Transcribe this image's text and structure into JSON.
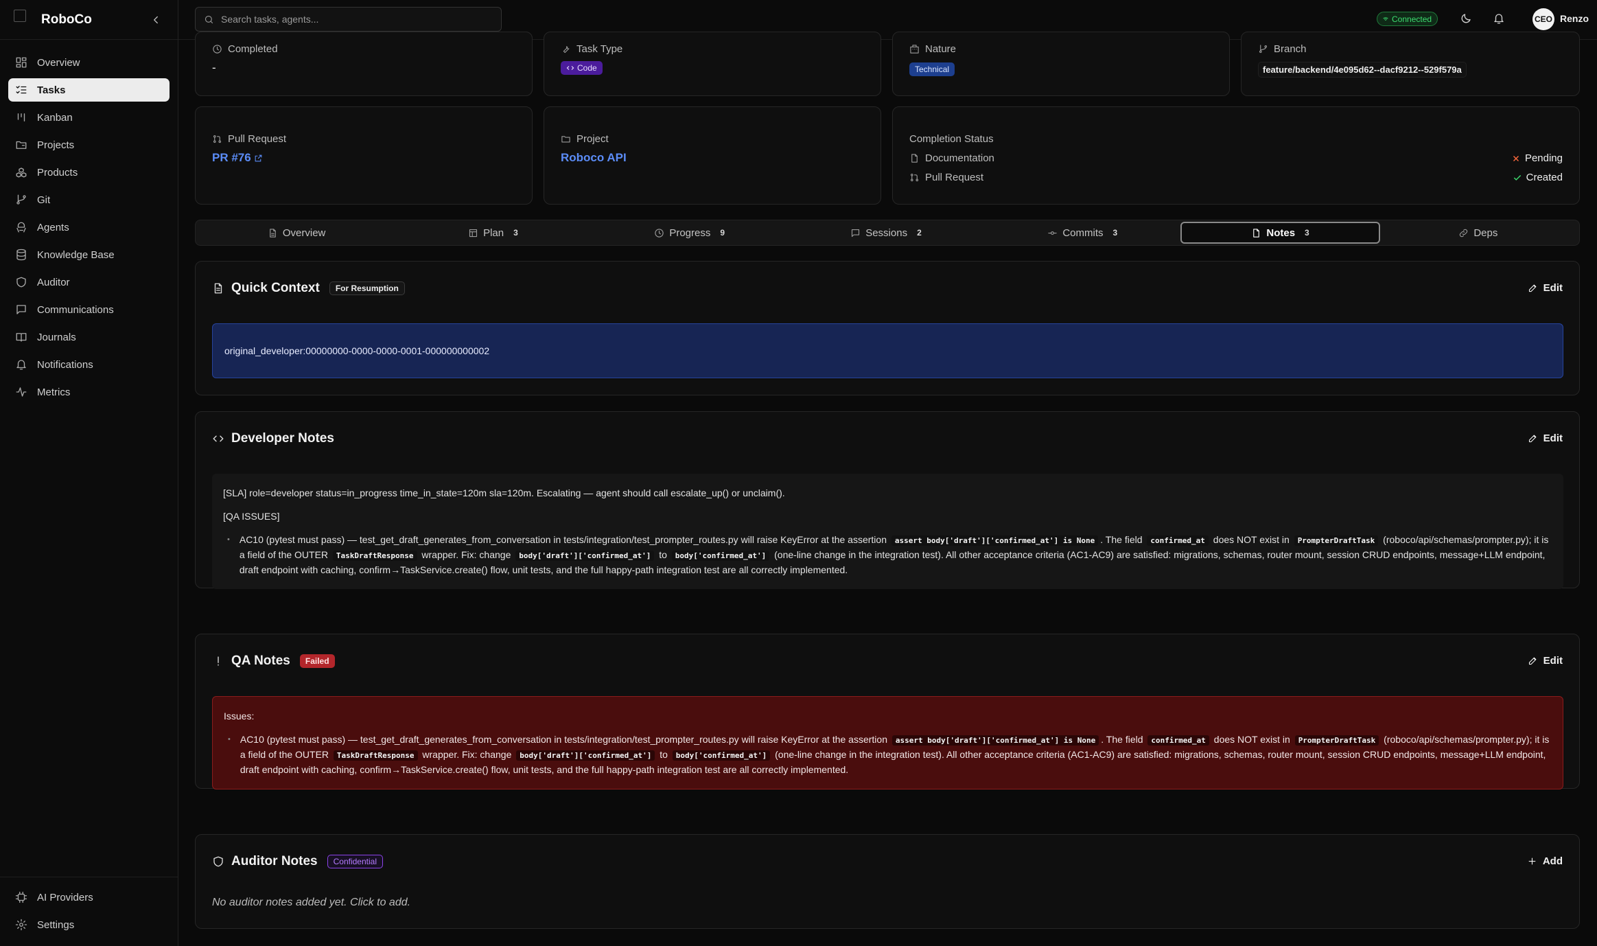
{
  "brand": {
    "name": "RoboCo"
  },
  "nav": [
    {
      "label": "Overview",
      "icon": "grid-icon",
      "active": false
    },
    {
      "label": "Tasks",
      "icon": "list-checks-icon",
      "active": true
    },
    {
      "label": "Kanban",
      "icon": "kanban-icon",
      "active": false
    },
    {
      "label": "Projects",
      "icon": "folder-icon",
      "active": false
    },
    {
      "label": "Products",
      "icon": "boxes-icon",
      "active": false
    },
    {
      "label": "Git",
      "icon": "git-branch-icon",
      "active": false
    },
    {
      "label": "Agents",
      "icon": "bot-icon",
      "active": false
    },
    {
      "label": "Knowledge Base",
      "icon": "database-icon",
      "active": false
    },
    {
      "label": "Auditor",
      "icon": "shield-icon",
      "active": false
    },
    {
      "label": "Communications",
      "icon": "message-icon",
      "active": false
    },
    {
      "label": "Journals",
      "icon": "book-icon",
      "active": false
    },
    {
      "label": "Notifications",
      "icon": "bell-icon",
      "active": false
    },
    {
      "label": "Metrics",
      "icon": "activity-icon",
      "active": false
    }
  ],
  "nav_bottom": [
    {
      "label": "AI Providers",
      "icon": "cpu-icon"
    },
    {
      "label": "Settings",
      "icon": "gear-icon"
    }
  ],
  "topbar": {
    "search_placeholder": "Search tasks, agents...",
    "status": "Connected",
    "avatar": "CEO",
    "user": "Renzo"
  },
  "meta": {
    "completed_label": "Completed",
    "completed_value": "-",
    "task_type_label": "Task Type",
    "task_type_value": "Code",
    "nature_label": "Nature",
    "nature_value": "Technical",
    "branch_label": "Branch",
    "branch_value": "feature/backend/4e095d62--dacf9212--529f579a",
    "pr_label": "Pull Request",
    "pr_value": "PR #76",
    "project_label": "Project",
    "project_value": "Roboco API",
    "completion_label": "Completion Status",
    "completion_rows": [
      {
        "label": "Documentation",
        "status": "Pending"
      },
      {
        "label": "Pull Request",
        "status": "Created"
      }
    ]
  },
  "tabs": [
    {
      "label": "Overview",
      "count": "",
      "icon": "file-icon"
    },
    {
      "label": "Plan",
      "count": "3",
      "icon": "layout-icon"
    },
    {
      "label": "Progress",
      "count": "9",
      "icon": "clock-icon"
    },
    {
      "label": "Sessions",
      "count": "2",
      "icon": "message-icon"
    },
    {
      "label": "Commits",
      "count": "3",
      "icon": "commit-icon"
    },
    {
      "label": "Notes",
      "count": "3",
      "icon": "note-icon",
      "active": true
    },
    {
      "label": "Deps",
      "count": "",
      "icon": "link-icon"
    }
  ],
  "quick_context": {
    "title": "Quick Context",
    "tag": "For Resumption",
    "edit": "Edit",
    "text": "original_developer:00000000-0000-0000-0001-000000000002"
  },
  "developer_notes": {
    "title": "Developer Notes",
    "edit": "Edit",
    "sla": "[SLA] role=developer status=in_progress time_in_state=120m sla=120m. Escalating — agent should call escalate_up() or unclaim().",
    "qa_header": "[QA ISSUES]"
  },
  "issue": {
    "t1": "AC10 (pytest must pass) — test_get_draft_generates_from_conversation in tests/integration/test_prompter_routes.py will raise KeyError at the assertion",
    "c1": "assert body['draft']['confirmed_at'] is None",
    "t2": ". The field",
    "c2": "confirmed_at",
    "t3": "does NOT exist in",
    "c3": "PrompterDraftTask",
    "t4": "(roboco/api/schemas/prompter.py); it is a field of the OUTER",
    "c4": "TaskDraftResponse",
    "t5": "wrapper. Fix: change",
    "c5": "body['draft']['confirmed_at']",
    "t6": "to",
    "c6": "body['confirmed_at']",
    "t7": "(one-line change in the integration test). All other acceptance criteria (AC1-AC9) are satisfied: migrations, schemas, router mount, session CRUD endpoints, message+LLM endpoint, draft endpoint with caching, confirm→TaskService.create() flow, unit tests, and the full happy-path integration test are all correctly implemented."
  },
  "qa_notes": {
    "title": "QA Notes",
    "tag": "Failed",
    "edit": "Edit",
    "issues_label": "Issues:"
  },
  "auditor_notes": {
    "title": "Auditor Notes",
    "tag": "Confidential",
    "add": "Add",
    "empty": "No auditor notes added yet. Click to add."
  },
  "colors": {
    "accent_link": "#5b8cf7",
    "connected": "#3ddc6f",
    "pending": "#ff6a3d",
    "created": "#3ddc6f",
    "failed": "#b3262b"
  }
}
